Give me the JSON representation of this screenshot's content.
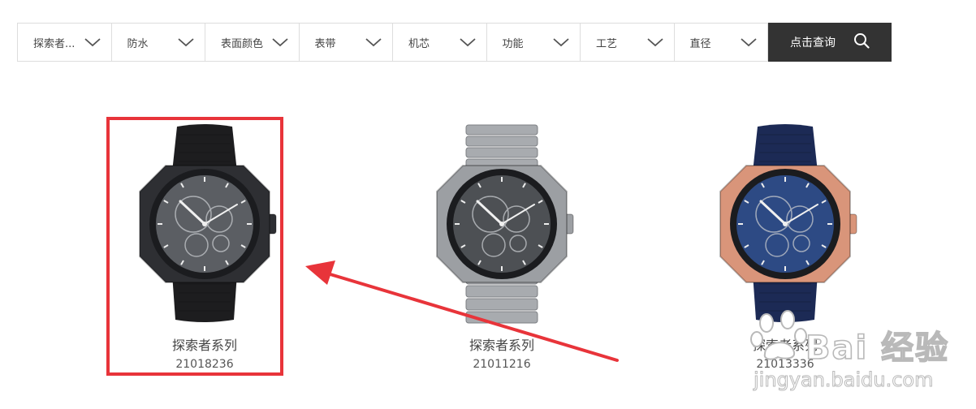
{
  "filters": [
    {
      "label": "探索者..."
    },
    {
      "label": "防水"
    },
    {
      "label": "表面颜色"
    },
    {
      "label": "表带"
    },
    {
      "label": "机芯"
    },
    {
      "label": "功能"
    },
    {
      "label": "工艺"
    },
    {
      "label": "直径"
    }
  ],
  "search": {
    "label": "点击查询",
    "icon": "search-icon"
  },
  "products": [
    {
      "series": "探索者系列",
      "code": "21018236",
      "case_color": "#2e2f33",
      "strap_color": "#1d1d1f",
      "dial_color": "#5b5e63",
      "strap_type": "leather"
    },
    {
      "series": "探索者系列",
      "code": "21011216",
      "case_color": "#9c9fa3",
      "strap_color": "#a8abaf",
      "dial_color": "#4d5054",
      "strap_type": "metal"
    },
    {
      "series": "探索者系列",
      "code": "21013336",
      "case_color": "#d9957a",
      "strap_color": "#1c2a55",
      "dial_color": "#2d4a84",
      "strap_type": "leather"
    }
  ],
  "watermark": {
    "brand": "Bai 经验",
    "url": "jingyan.baidu.com"
  },
  "annotation": {
    "color": "#e8343a"
  }
}
